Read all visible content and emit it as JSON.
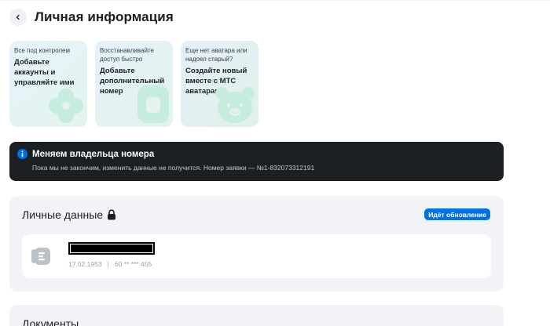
{
  "header": {
    "title": "Личная информация"
  },
  "promo_cards": [
    {
      "caption": "Все под контролем",
      "text": "Добавьте аккаунты и управляйте ими",
      "icon": "flower-icon"
    },
    {
      "caption": "Восстанавливайте доступ быстро",
      "text": "Добавьте дополнительный номер",
      "icon": "sim-card-icon"
    },
    {
      "caption": "Еще нет аватара или надоел старый?",
      "text": "Создайте новый вместе с МТС аватарами",
      "icon": "bear-icon"
    }
  ],
  "banner": {
    "title": "Меняем владельца номера",
    "text": "Пока мы не закончим, изменить данные не получится. Номер заявки — №1-832073312191"
  },
  "personal_data": {
    "title": "Личные данные",
    "status_badge": "Идёт обновление",
    "document": {
      "date": "17.02.1953",
      "separator": "|",
      "number": "60 ** *** 455"
    }
  },
  "documents": {
    "title": "Документы"
  },
  "colors": {
    "accent": "#0070e5",
    "dark_banner": "#1d2023",
    "section_bg": "#f2f3f7",
    "muted_text": "#969fa8",
    "promo_green": "#c6ecdd"
  }
}
